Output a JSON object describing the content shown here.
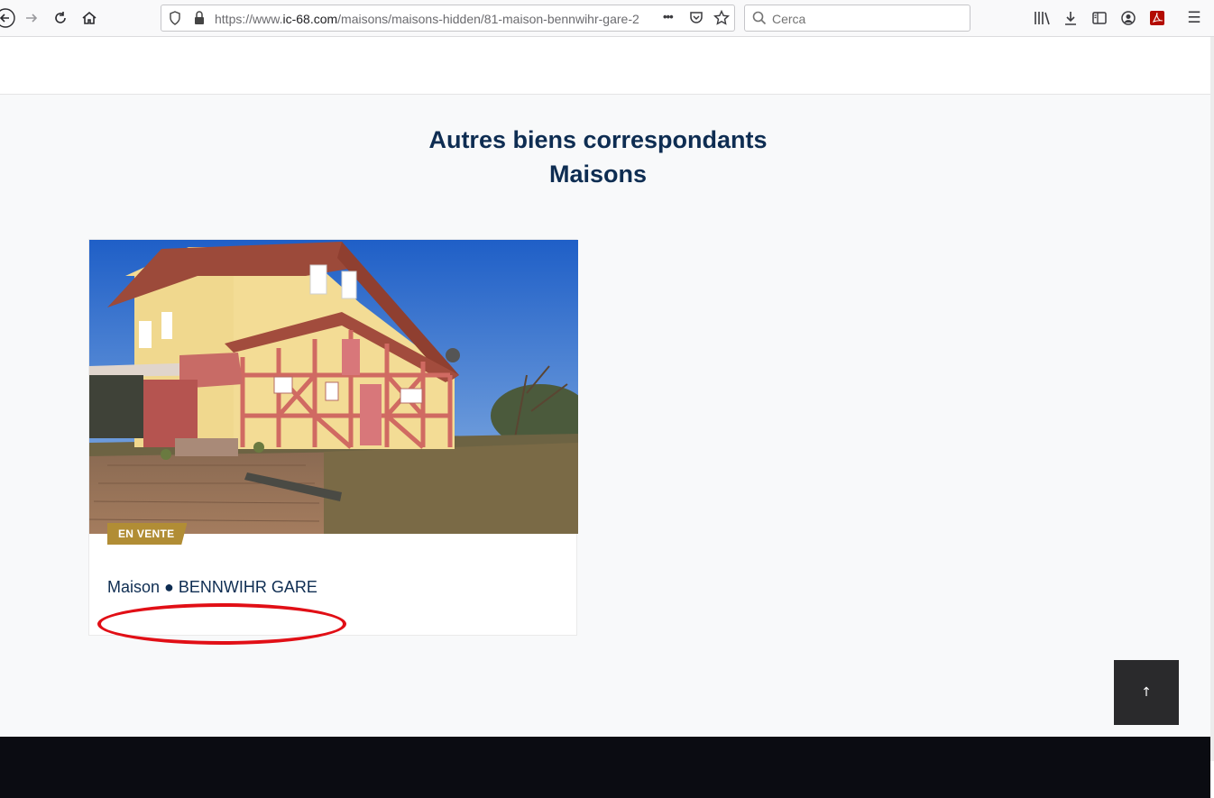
{
  "browser": {
    "url_prefix": "https://www.",
    "url_domain": "ic-68.com",
    "url_path": "/maisons/maisons-hidden/81-maison-bennwihr-gare-2",
    "search_placeholder": "Cerca",
    "icons": {
      "back": "back-arrow-icon",
      "forward": "forward-arrow-icon",
      "reload": "reload-icon",
      "home": "home-icon",
      "shield": "shield-icon",
      "lock": "lock-icon",
      "more": "more-icon",
      "pocket": "pocket-icon",
      "bookmark": "star-icon",
      "search": "search-icon",
      "library": "library-icon",
      "downloads": "download-icon",
      "sidebar": "sidebar-icon",
      "account": "account-icon",
      "pdf": "pdf-icon",
      "menu": "hamburger-menu-icon"
    },
    "more_glyph": "•••",
    "menu_glyph": "☰"
  },
  "section": {
    "title_line1": "Autres biens correspondants",
    "title_line2": "Maisons"
  },
  "listing": {
    "badge": "EN VENTE",
    "title": "Maison ● BENNWIHR GARE",
    "image_icon": "house-photo"
  },
  "scroll_top": {
    "glyph": "↑",
    "icon": "arrow-up-icon"
  },
  "colors": {
    "title": "#0e2d52",
    "badge": "#b18d35",
    "footer": "#0b0c12",
    "annotation": "#e10f16"
  }
}
